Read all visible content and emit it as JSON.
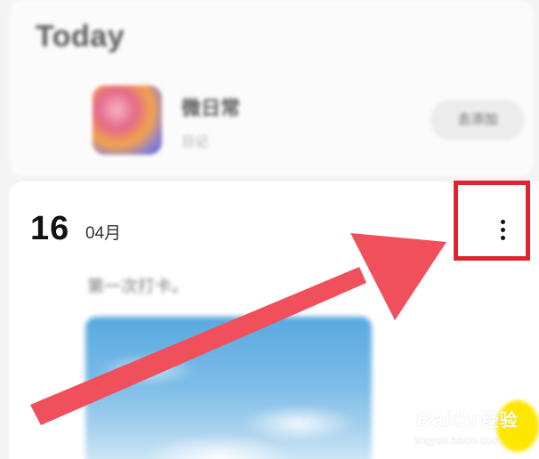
{
  "today_section": {
    "title": "Today",
    "app": {
      "name": "微日常",
      "subtitle": "日记",
      "action_label": "去添加"
    }
  },
  "entry": {
    "day": "16",
    "month": "04月",
    "text": "第一次打卡。",
    "more_icon": "more-vertical-icon"
  },
  "annotation": {
    "highlight_color": "#e0242f",
    "arrow_color": "#f0505c"
  },
  "watermark": {
    "brand": "Bai",
    "brand_suffix": "du",
    "brand_cn": "经验",
    "url": "jingyan.baidu.com"
  }
}
